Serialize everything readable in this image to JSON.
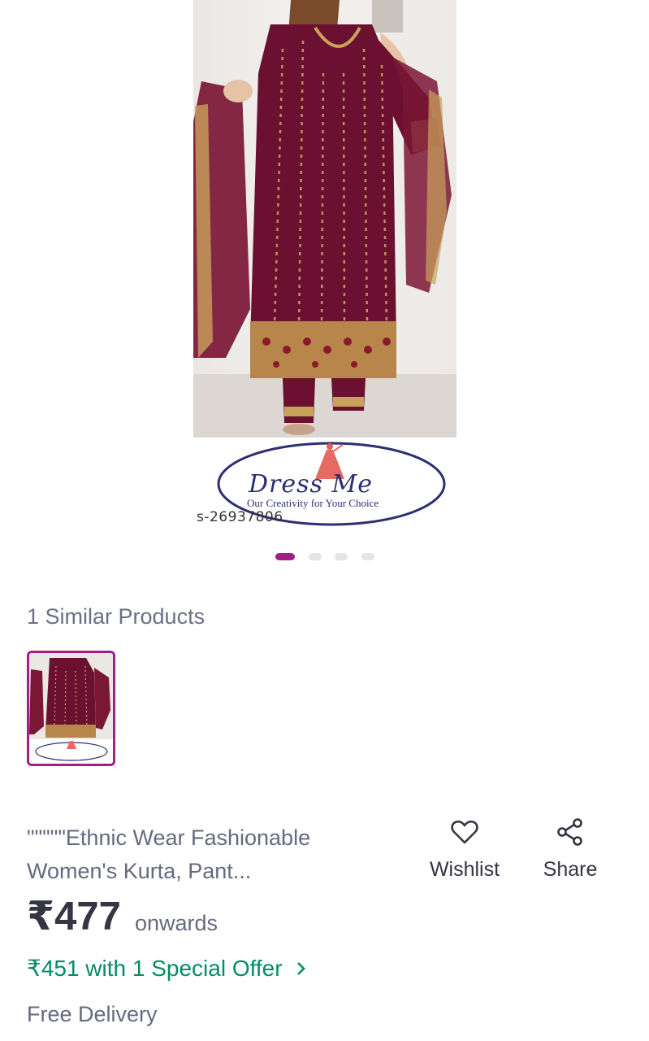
{
  "product_image": {
    "brand_logo_text": "Dress Me",
    "brand_tagline": "Our Creativity for Your Choice",
    "sku_overlay": "s-26937806"
  },
  "carousel": {
    "total_slides": 4,
    "active_index": 0
  },
  "similar": {
    "title": "1 Similar Products",
    "count": 1
  },
  "product": {
    "title": "\"\"\"\"\"Ethnic Wear Fashionable Women's Kurta, Pant...",
    "price": "₹477",
    "price_suffix": "onwards",
    "offer_text": "₹451 with 1 Special Offer",
    "delivery_text": "Free Delivery"
  },
  "actions": {
    "wishlist_label": "Wishlist",
    "wishlist_icon": "heart-icon",
    "share_label": "Share",
    "share_icon": "share-icon"
  },
  "colors": {
    "accent": "#9f2089",
    "offer_green": "#038d63",
    "text_dark": "#353543",
    "text_muted": "#666a7d",
    "garment": "#6b1030",
    "embroidery": "#c9a25a"
  }
}
